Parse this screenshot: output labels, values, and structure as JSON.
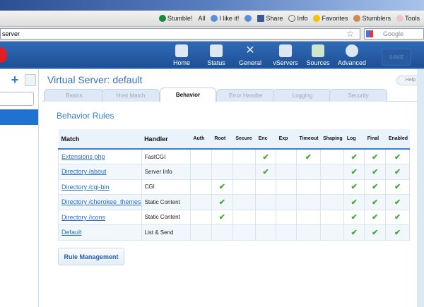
{
  "browser": {
    "toolbar": [
      "Stumble!",
      "All",
      "I like it!",
      "Share",
      "Info",
      "Favorites",
      "Stumblers",
      "Tools"
    ],
    "url": "server",
    "search_placeholder": "Google"
  },
  "nav": [
    {
      "label": "Home"
    },
    {
      "label": "Status"
    },
    {
      "label": "General"
    },
    {
      "label": "vServers"
    },
    {
      "label": "Sources"
    },
    {
      "label": "Advanced"
    }
  ],
  "save_label": "SAVE",
  "page_title": "Virtual Server: default",
  "help_label": "Help",
  "tabs": [
    "Basics",
    "Host Match",
    "Behavior",
    "Error Handler",
    "Logging",
    "Security"
  ],
  "active_tab": "Behavior",
  "section_title": "Behavior Rules",
  "table": {
    "headers": [
      "Match",
      "Handler",
      "Auth",
      "Root",
      "Secure",
      "Enc",
      "Exp",
      "Timeout",
      "Shaping",
      "Log",
      "Final",
      "Enabled"
    ],
    "rows": [
      {
        "match": "Extensions php",
        "handler": "FastCGI",
        "flags": [
          0,
          0,
          0,
          1,
          0,
          1,
          0,
          1,
          1,
          1
        ]
      },
      {
        "match": "Directory /about",
        "handler": "Server Info",
        "flags": [
          0,
          0,
          0,
          1,
          0,
          0,
          0,
          1,
          1,
          1
        ]
      },
      {
        "match": "Directory /cgi-bin",
        "handler": "CGI",
        "flags": [
          0,
          1,
          0,
          0,
          0,
          0,
          0,
          1,
          1,
          1
        ]
      },
      {
        "match": "Directory /cherokee_themes",
        "handler": "Static Content",
        "flags": [
          0,
          1,
          0,
          0,
          0,
          0,
          0,
          1,
          1,
          1
        ]
      },
      {
        "match": "Directory /icons",
        "handler": "Static Content",
        "flags": [
          0,
          1,
          0,
          0,
          0,
          0,
          0,
          1,
          1,
          1
        ]
      },
      {
        "match": "Default",
        "handler": "List & Send",
        "flags": [
          0,
          0,
          0,
          0,
          0,
          0,
          0,
          1,
          1,
          1
        ]
      }
    ]
  },
  "rule_management_label": "Rule Management",
  "check_glyph": "✔"
}
